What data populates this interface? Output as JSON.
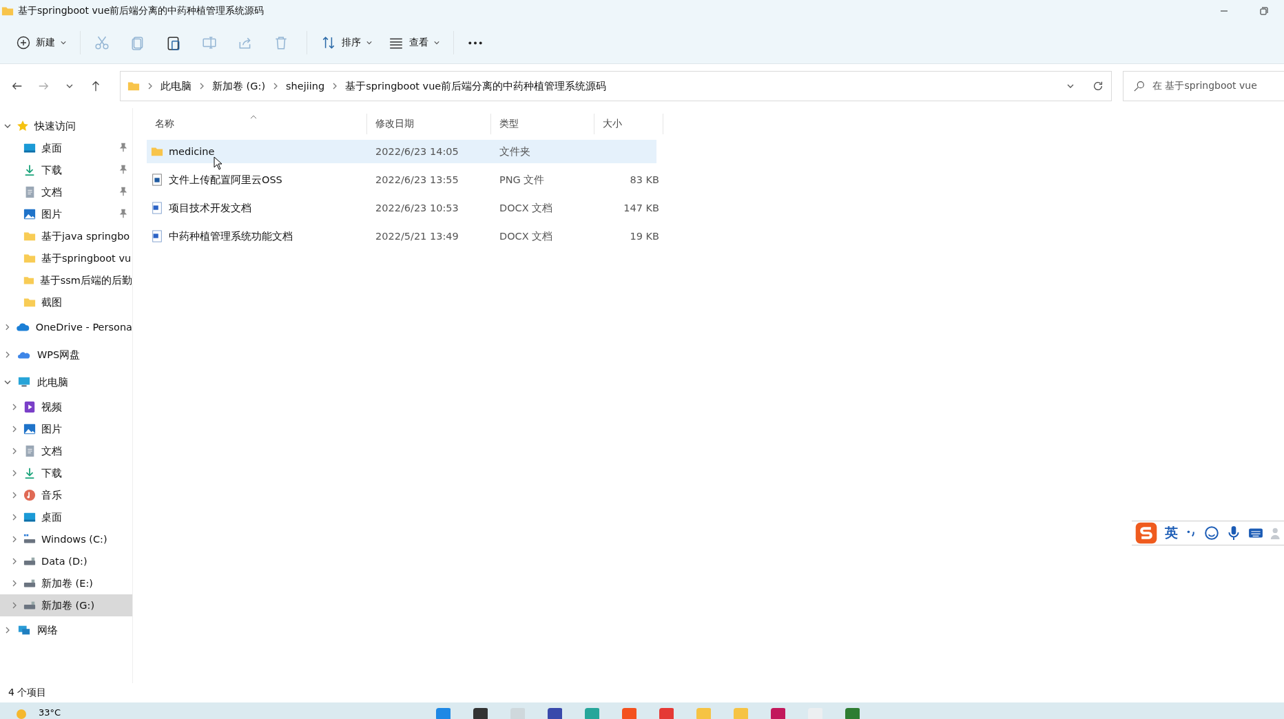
{
  "window": {
    "title": "基于springboot vue前后端分离的中药种植管理系统源码"
  },
  "toolbar": [
    {
      "kind": "new",
      "label": "新建",
      "disabled": false
    },
    {
      "kind": "cut",
      "disabled": true
    },
    {
      "kind": "copy",
      "disabled": true
    },
    {
      "kind": "paste",
      "disabled": false
    },
    {
      "kind": "rename",
      "disabled": true
    },
    {
      "kind": "share",
      "disabled": true
    },
    {
      "kind": "delete",
      "disabled": true
    },
    {
      "kind": "sort",
      "label": "排序",
      "disabled": false
    },
    {
      "kind": "view",
      "label": "查看",
      "disabled": false
    },
    {
      "kind": "more",
      "disabled": false
    }
  ],
  "address_bar": {
    "crumbs": [
      "此电脑",
      "新加卷 (G:)",
      "shejiing",
      "基于springboot vue前后端分离的中药种植管理系统源码"
    ]
  },
  "search": {
    "placeholder": "在 基于springboot vue"
  },
  "sidebar": {
    "items": [
      {
        "kind": "star",
        "label": "快速访问",
        "expanded": true,
        "selected": false,
        "children": [
          {
            "kind": "desktop",
            "label": "桌面",
            "pinned": true,
            "selected": false
          },
          {
            "kind": "download",
            "label": "下载",
            "pinned": true,
            "selected": false
          },
          {
            "kind": "document",
            "label": "文档",
            "pinned": true,
            "selected": false
          },
          {
            "kind": "picture",
            "label": "图片",
            "pinned": true,
            "selected": false
          },
          {
            "kind": "folder",
            "label": "基于java springbo",
            "pinned": false,
            "selected": false
          },
          {
            "kind": "folder",
            "label": "基于springboot vu",
            "pinned": false,
            "selected": false
          },
          {
            "kind": "folder",
            "label": "基于ssm后端的后勤",
            "pinned": false,
            "selected": false
          },
          {
            "kind": "folder",
            "label": "截图",
            "pinned": false,
            "selected": false
          }
        ]
      },
      {
        "kind": "cloud",
        "label": "OneDrive - Persona",
        "expanded": false,
        "selected": false
      },
      {
        "kind": "wps",
        "label": "WPS网盘",
        "expanded": false,
        "selected": false
      },
      {
        "kind": "pc",
        "label": "此电脑",
        "expanded": true,
        "selected": false,
        "children": [
          {
            "kind": "video",
            "label": "视频",
            "expanded": false,
            "selected": false
          },
          {
            "kind": "picture",
            "label": "图片",
            "expanded": false,
            "selected": false
          },
          {
            "kind": "document",
            "label": "文档",
            "expanded": false,
            "selected": false
          },
          {
            "kind": "download",
            "label": "下载",
            "expanded": false,
            "selected": false
          },
          {
            "kind": "music",
            "label": "音乐",
            "expanded": false,
            "selected": false
          },
          {
            "kind": "desktop",
            "label": "桌面",
            "expanded": false,
            "selected": false
          },
          {
            "kind": "windrive",
            "label": "Windows (C:)",
            "expanded": false,
            "selected": false
          },
          {
            "kind": "drive",
            "label": "Data (D:)",
            "expanded": false,
            "selected": false
          },
          {
            "kind": "drive",
            "label": "新加卷 (E:)",
            "expanded": false,
            "selected": false
          },
          {
            "kind": "drive",
            "label": "新加卷 (G:)",
            "expanded": false,
            "selected": true
          }
        ]
      },
      {
        "kind": "network",
        "label": "网络",
        "expanded": false,
        "selected": false
      }
    ]
  },
  "table": {
    "columns": [
      "名称",
      "修改日期",
      "类型",
      "大小"
    ],
    "rows": [
      {
        "kind": "folder",
        "name": "medicine",
        "date": "2022/6/23 14:05",
        "type": "文件夹",
        "selected": true
      },
      {
        "kind": "image",
        "name": "文件上传配置阿里云OSS",
        "date": "2022/6/23 13:55",
        "type": "PNG 文件",
        "size": "83 KB",
        "selected": false
      },
      {
        "kind": "word",
        "name": "项目技术开发文档",
        "date": "2022/6/23 10:53",
        "type": "DOCX 文档",
        "size": "147 KB",
        "selected": false
      },
      {
        "kind": "word",
        "name": "中药种植管理系统功能文档",
        "date": "2022/5/21 13:49",
        "type": "DOCX 文档",
        "size": "19 KB",
        "selected": false
      }
    ]
  },
  "status_bar": {
    "count": "4 个项目"
  },
  "ime": {
    "mode": "英"
  },
  "taskbar": {
    "weather": "33°C"
  }
}
